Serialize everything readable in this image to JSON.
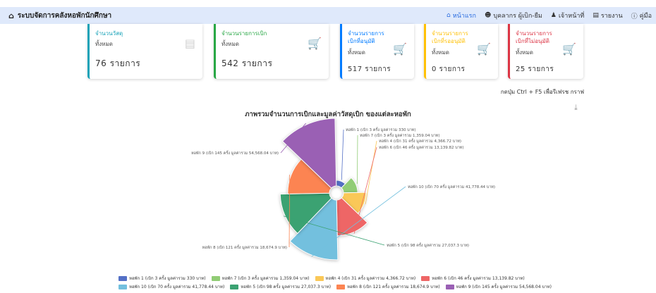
{
  "navbar": {
    "brand": "ระบบจัดการคลังหอพักนักศึกษา",
    "menu": [
      {
        "label": "หน้าแรก",
        "icon": "home-icon"
      },
      {
        "label": "บุคลากร ผู้เบิก-ยืม",
        "icon": "users-icon"
      },
      {
        "label": "เจ้าหน้าที่",
        "icon": "user-icon"
      },
      {
        "label": "รายงาน",
        "icon": "report-icon"
      },
      {
        "label": "คู่มือ",
        "icon": "info-icon"
      }
    ]
  },
  "cards": [
    {
      "label": "จำนวนวัสดุ",
      "sub": "ทั้งหมด",
      "value": "76 รายการ",
      "color": "#17a2b8",
      "icon": "list-icon"
    },
    {
      "label": "จำนวนรายการเบิก",
      "sub": "ทั้งหมด",
      "value": "542 รายการ",
      "color": "#28a745",
      "icon": "cart-icon"
    },
    {
      "label": "จำนวนรายการ",
      "label2": "เบิกที่อนุมัติ",
      "sub": "ทั้งหมด",
      "value": "517 รายการ",
      "color": "#007bff",
      "icon": "cart-icon"
    },
    {
      "label": "จำนวนรายการ",
      "label2": "เบิกที่รออนุมัติ",
      "sub": "ทั้งหมด",
      "value": "0 รายการ",
      "color": "#ffc107",
      "icon": "cart-icon"
    },
    {
      "label": "จำนวนรายการ",
      "label2": "เบิกที่ไม่อนุมัติ",
      "sub": "ทั้งหมด",
      "value": "25 รายการ",
      "color": "#dc3545",
      "icon": "cart-icon"
    }
  ],
  "hint": "กดปุ่ม Ctrl + F5 เพื่อรีเฟรช กราฟ",
  "chart_data": {
    "type": "pie",
    "title": "ภาพรวมจำนวนการเบิกและมูลค่าวัสดุเบิก ของแต่ละหอพัก",
    "slices": [
      {
        "name": "หอพัก 1",
        "count": 3,
        "value": 330,
        "label": "หอพัก 1 (เบิก 3 ครั้ง มูลค่ารวม 330 บาท)",
        "legend": "หอพัก 1 (เบิก 3 ครั้ง มูลค่ารวม 330 บาท)",
        "color": "#5470c6"
      },
      {
        "name": "หอพัก 7",
        "count": 3,
        "value": 1359.04,
        "label": "หอพัก 7 (เบิก 3 ครั้ง มูลค่ารวม 1,359.04 บาท)",
        "legend": "หอพัก 7 (เบิก 3 ครั้ง มูลค่ารวม 1,359.04 บาท)",
        "color": "#91cc75"
      },
      {
        "name": "หอพัก 4",
        "count": 31,
        "value": 4366.72,
        "label": "หอพัก 4 (เบิก 31 ครั้ง มูลค่ารวม 4,366.72 บาท)",
        "legend": "หอพัก 4 (เบิก 31 ครั้ง มูลค่ารวม 4,366.72 บาท)",
        "color": "#fac858"
      },
      {
        "name": "หอพัก 6",
        "count": 46,
        "value": 13139.82,
        "label": "หอพัก 6 (เบิก 46 ครั้ง มูลค่ารวม 13,139.82 บาท)",
        "legend": "หอพัก 6 (เบิก 46 ครั้ง มูลค่ารวม 13,139.82 บาท)",
        "color": "#ee6666"
      },
      {
        "name": "หอพัก 10",
        "count": 70,
        "value": 41778.44,
        "label": "หอพัก 10 (เบิก 70 ครั้ง มูลค่ารวม 41,778.44 บาท)",
        "legend": "หอพัก 10 (เบิก 70 ครั้ง มูลค่ารวม 41,778.44 บาท)",
        "color": "#73c0de"
      },
      {
        "name": "หอพัก 5",
        "count": 98,
        "value": 27037.3,
        "label": "หอพัก 5 (เบิก 98 ครั้ง มูลค่ารวม 27,037.3 บาท)",
        "legend": "หอพัก 5 (เบิก 98 ครั้ง มูลค่ารวม 27,037.3 บาท)",
        "color": "#3ba272"
      },
      {
        "name": "หอพัก 8",
        "count": 121,
        "value": 18674.9,
        "label": "หอพัก 8 (เบิก 121 ครั้ง มูลค่ารวม 18,674.9 บาท)",
        "legend": "หอพัก 8 (เบิก 121 ครั้ง มูลค่ารวม 18,674.9 บาท)",
        "color": "#fc8452"
      },
      {
        "name": "หอพัก 9",
        "count": 145,
        "value": 54568.04,
        "label": "หอพัก 9 (เบิก 145 ครั้ง มูลค่ารวม 54,568.04 บาท)",
        "legend": "หอพัก 9 (เบิก 145 ครั้ง มูลค่ารวม 54,568.04 บาท)",
        "color": "#9a60b4"
      }
    ]
  }
}
